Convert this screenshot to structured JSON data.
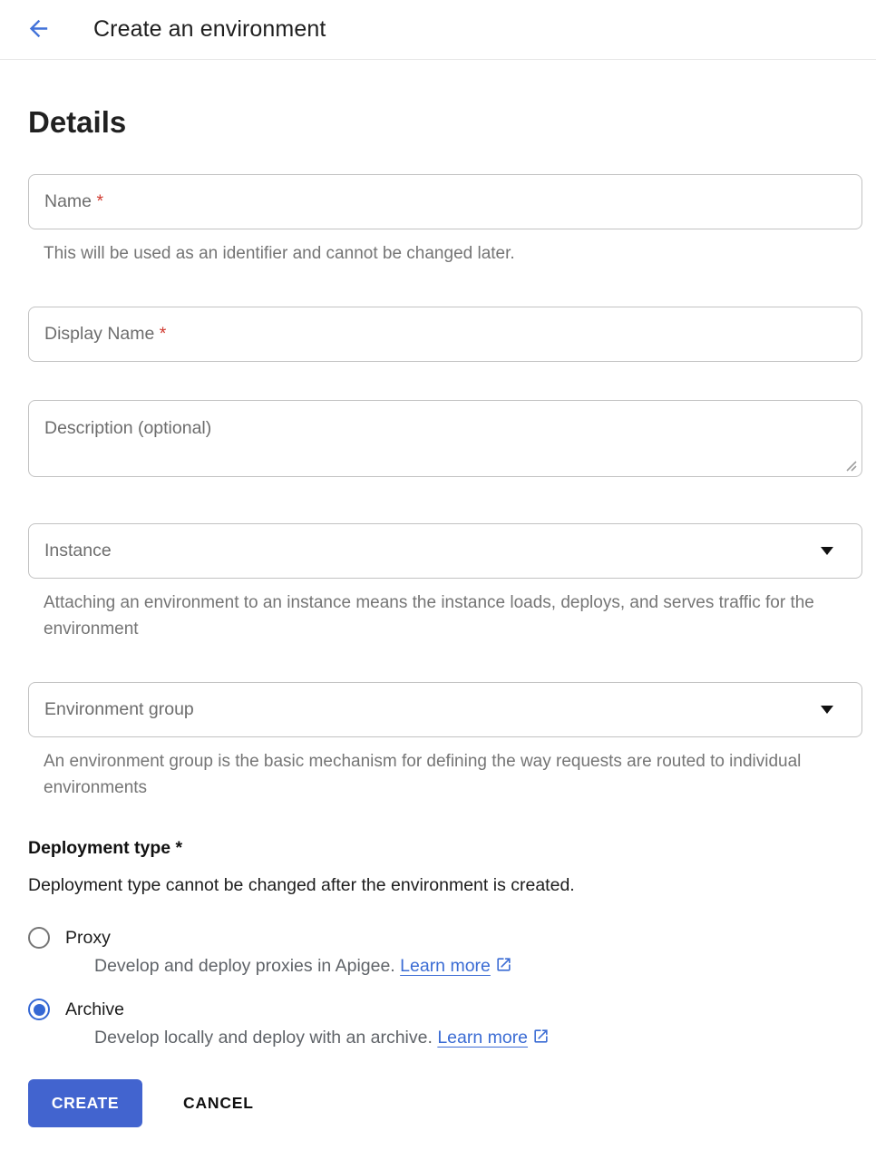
{
  "header": {
    "title": "Create an environment"
  },
  "section": {
    "title": "Details"
  },
  "fields": {
    "name": {
      "placeholder": "Name ",
      "required_mark": "*",
      "helper": "This will be used as an identifier and cannot be changed later."
    },
    "display_name": {
      "placeholder": "Display Name ",
      "required_mark": "*"
    },
    "description": {
      "placeholder": "Description (optional)"
    },
    "instance": {
      "label": "Instance",
      "helper": "Attaching an environment to an instance means the instance loads, deploys, and serves traffic for the environment"
    },
    "environment_group": {
      "label": "Environment group",
      "helper": "An environment group is the basic mechanism for defining the way requests are routed to individual environments"
    }
  },
  "deployment": {
    "label": "Deployment type *",
    "note": "Deployment type cannot be changed after the environment is created.",
    "options": [
      {
        "label": "Proxy",
        "description": "Develop and deploy proxies in Apigee. ",
        "link_label": "Learn more",
        "selected": false
      },
      {
        "label": "Archive",
        "description": "Develop locally and deploy with an archive. ",
        "link_label": "Learn more",
        "selected": true
      }
    ]
  },
  "actions": {
    "create_label": "CREATE",
    "cancel_label": "CANCEL"
  },
  "icons": {
    "back": "arrow-back-icon",
    "dropdown": "arrow-drop-down-icon",
    "external": "open-in-new-icon",
    "resize": "resize-grip-icon"
  },
  "colors": {
    "accent_button_blue": "#4264cf",
    "link_blue": "#3b6cd4",
    "radio_selected_blue": "#3568d4",
    "required_red": "#d13c32",
    "helper_gray": "#757575",
    "border_gray": "#c2c2c2"
  }
}
